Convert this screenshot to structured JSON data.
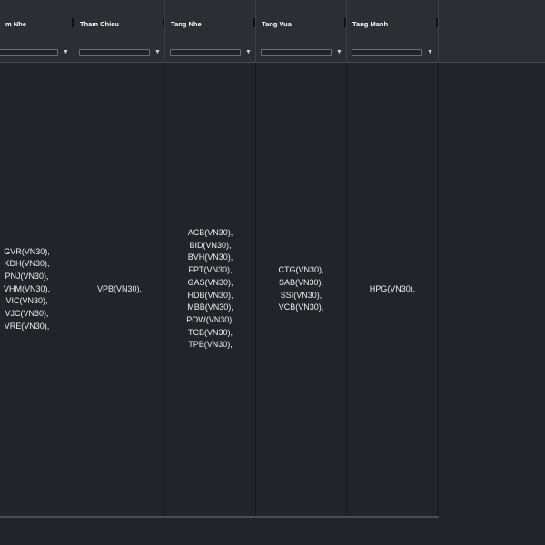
{
  "columns": [
    {
      "header": "m Nhe",
      "values": [
        "GVR(VN30),",
        "KDH(VN30),",
        "PNJ(VN30),",
        "VHM(VN30),",
        "VIC(VN30),",
        "VJC(VN30),",
        "VRE(VN30),"
      ]
    },
    {
      "header": "Tham Chieu",
      "values": [
        "VPB(VN30),"
      ]
    },
    {
      "header": "Tang Nhe",
      "values": [
        "ACB(VN30),",
        "BID(VN30),",
        "BVH(VN30),",
        "FPT(VN30),",
        "GAS(VN30),",
        "HDB(VN30),",
        "MBB(VN30),",
        "POW(VN30),",
        "TCB(VN30),",
        "TPB(VN30),"
      ]
    },
    {
      "header": "Tang Vua",
      "values": [
        "CTG(VN30),",
        "SAB(VN30),",
        "SSI(VN30),",
        "VCB(VN30),"
      ]
    },
    {
      "header": "Tang Manh",
      "values": [
        "HPG(VN30),"
      ]
    }
  ],
  "filter_icon": "funnel-icon",
  "colors": {
    "background": "#212529",
    "header": "#2b2f33",
    "text": "#f0f0f0"
  }
}
